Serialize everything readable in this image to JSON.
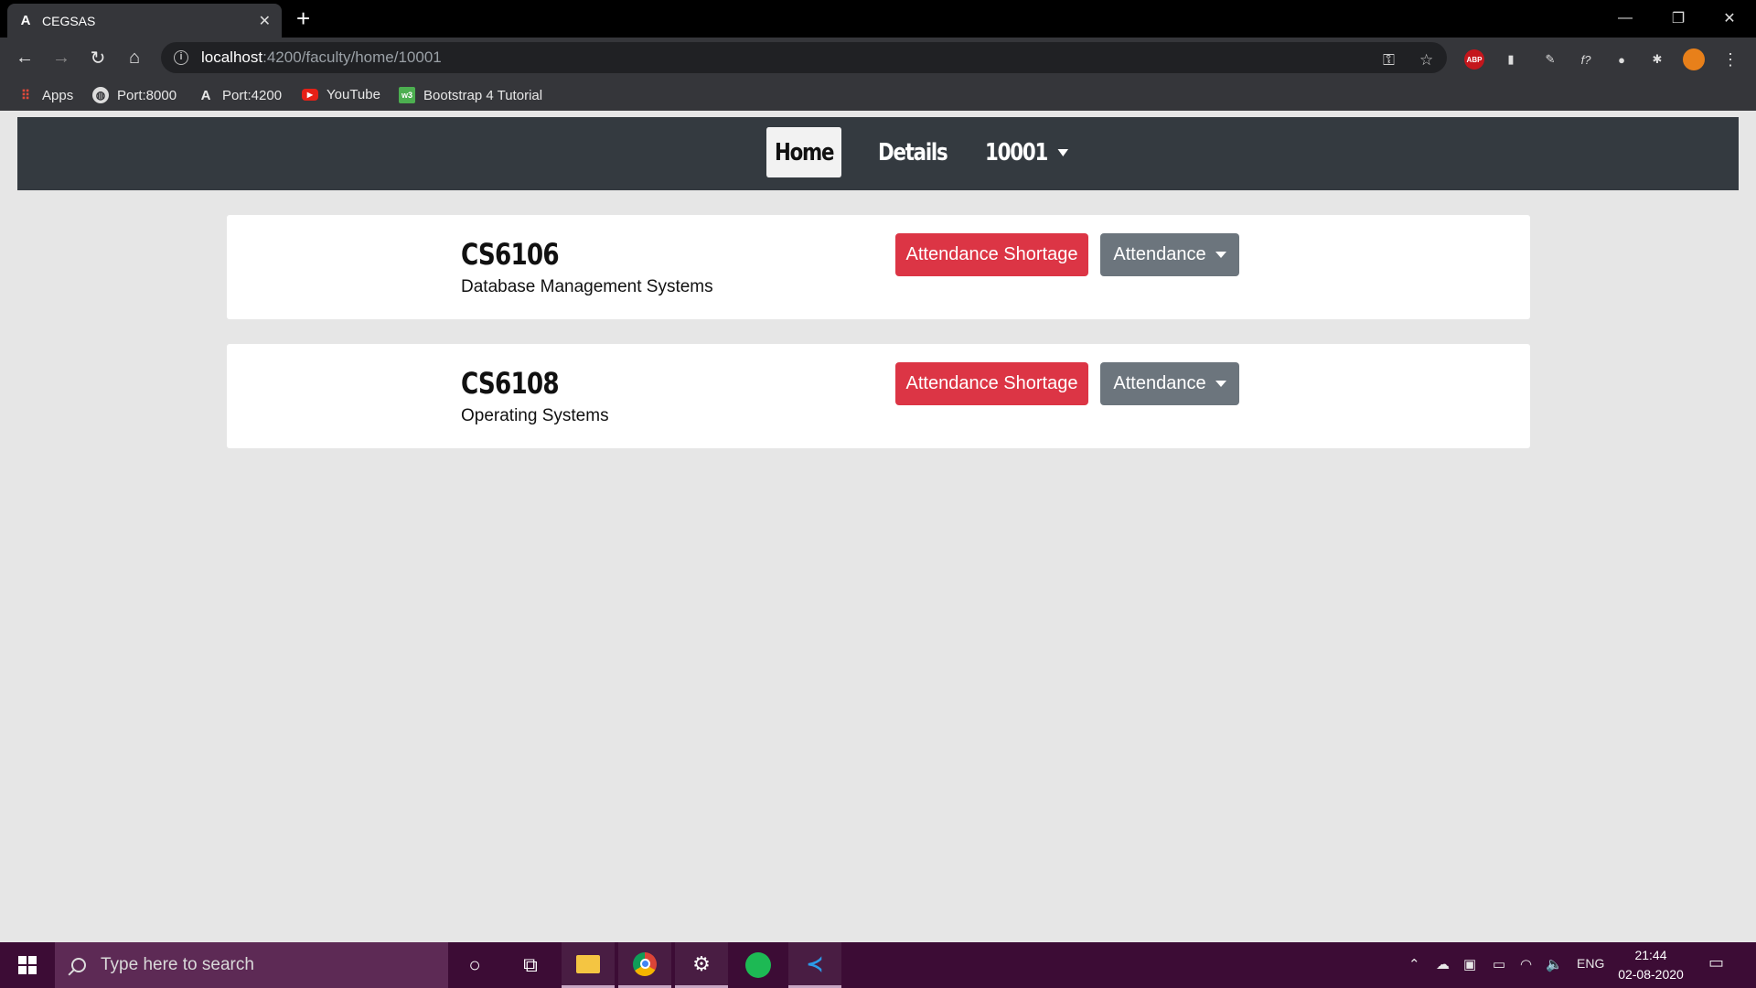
{
  "browser": {
    "tab_title": "CEGSAS",
    "tab_icon": "angular-icon",
    "url_host": "localhost",
    "url_path": ":4200/faculty/home/10001",
    "bookmarks": [
      {
        "label": "Apps",
        "icon": "apps-grid-icon"
      },
      {
        "label": "Port:8000",
        "icon": "globe-icon"
      },
      {
        "label": "Port:4200",
        "icon": "angular-icon"
      },
      {
        "label": "YouTube",
        "icon": "youtube-icon"
      },
      {
        "label": "Bootstrap 4 Tutorial",
        "icon": "w3schools-icon"
      }
    ]
  },
  "navbar": {
    "home": "Home",
    "details": "Details",
    "user": "10001"
  },
  "courses": [
    {
      "code": "CS6106",
      "name": "Database Management Systems",
      "shortage_label": "Attendance Shortage",
      "attendance_label": "Attendance"
    },
    {
      "code": "CS6108",
      "name": "Operating Systems",
      "shortage_label": "Attendance Shortage",
      "attendance_label": "Attendance"
    }
  ],
  "taskbar": {
    "search_placeholder": "Type here to search",
    "language": "ENG",
    "time": "21:44",
    "date": "02-08-2020"
  },
  "colors": {
    "navbar_bg": "#343a40",
    "danger": "#dc3545",
    "secondary": "#6c757d",
    "taskbar_bg": "#3c0c35"
  }
}
